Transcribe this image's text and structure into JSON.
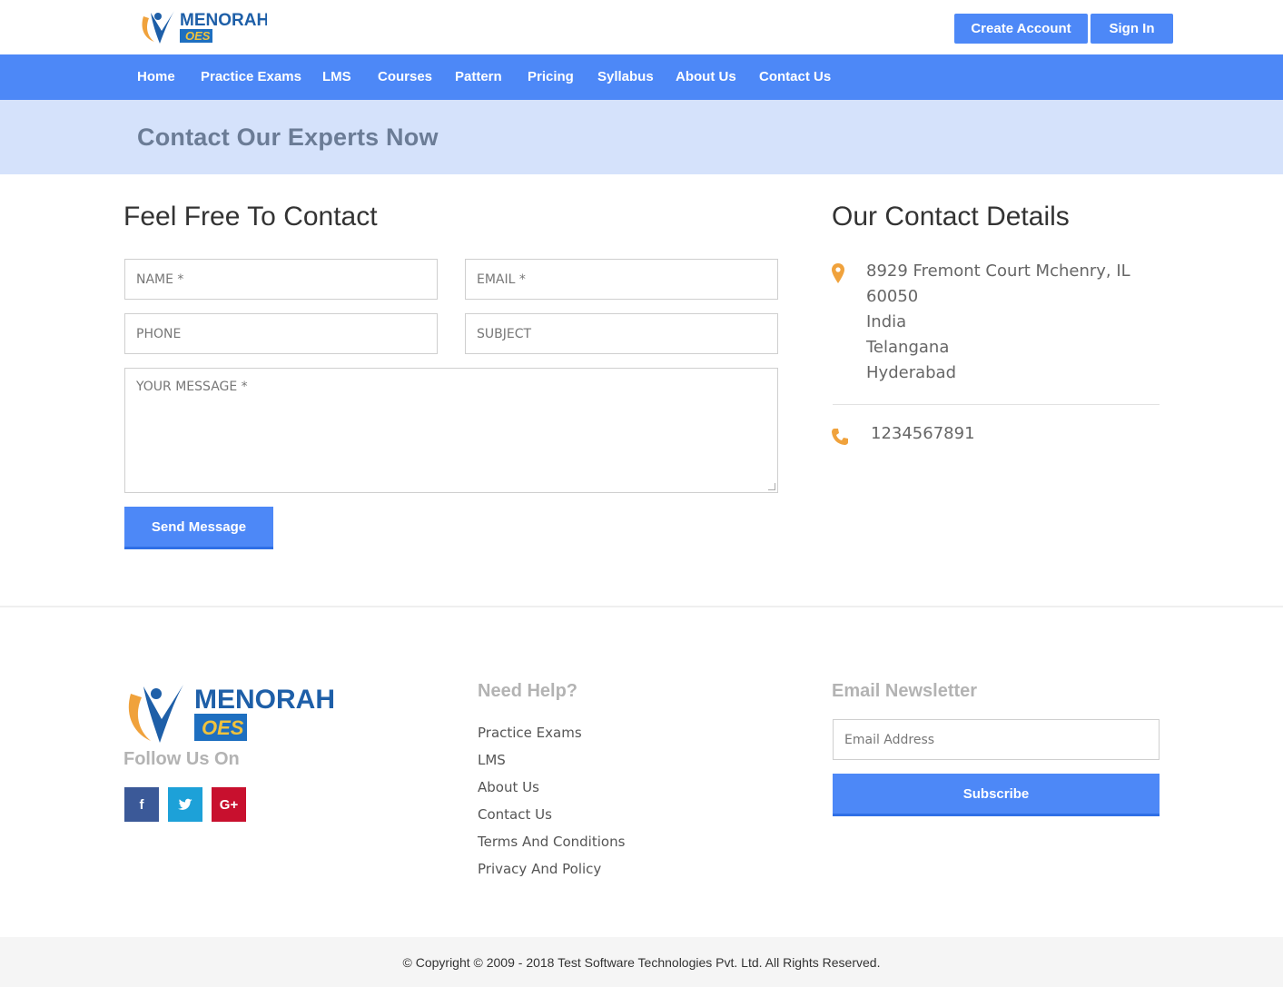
{
  "brand": {
    "name": "MENORAH",
    "sub": "OES"
  },
  "header": {
    "create_account": "Create Account",
    "sign_in": "Sign In"
  },
  "nav": {
    "items": [
      "Home",
      "Practice Exams",
      "LMS",
      "Courses",
      "Pattern",
      "Pricing",
      "Syllabus",
      "About Us",
      "Contact Us"
    ]
  },
  "banner": {
    "title": "Contact Our Experts Now"
  },
  "form": {
    "heading": "Feel Free To Contact",
    "name_placeholder": "NAME *",
    "email_placeholder": "EMAIL *",
    "phone_placeholder": "PHONE",
    "subject_placeholder": "SUBJECT",
    "message_placeholder": "YOUR MESSAGE *",
    "send_label": "Send Message"
  },
  "details": {
    "heading": "Our Contact Details",
    "address_lines": [
      "8929 Fremont Court Mchenry, IL",
      "60050",
      "India",
      "Telangana",
      "Hyderabad"
    ],
    "phone": "1234567891",
    "pin_icon": "map-marker-icon",
    "phone_icon": "phone-icon",
    "icon_color": "#f0a23c"
  },
  "footer": {
    "follow_heading": "Follow Us On",
    "social": [
      {
        "icon": "facebook-icon",
        "glyph": "f",
        "color": "#3b5998"
      },
      {
        "icon": "twitter-icon",
        "glyph": "t",
        "color": "#1da1d8"
      },
      {
        "icon": "google-plus-icon",
        "glyph": "G+",
        "color": "#c8102e"
      }
    ],
    "help_heading": "Need Help?",
    "help_links": [
      "Practice Exams",
      "LMS",
      "About Us",
      "Contact Us",
      "Terms And Conditions",
      "Privacy And Policy"
    ],
    "newsletter_heading": "Email Newsletter",
    "newsletter_placeholder": "Email Address",
    "subscribe_label": "Subscribe",
    "copyright": "© Copyright © 2009 - 2018 Test Software Technologies Pvt. Ltd. All Rights Reserved."
  },
  "colors": {
    "accent": "#4d88f7",
    "banner_bg": "#d5e2fb",
    "icon_orange": "#f0a23c"
  }
}
